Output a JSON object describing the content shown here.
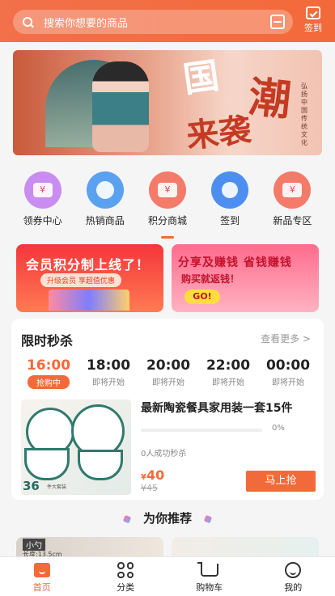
{
  "header": {
    "search_placeholder": "搜索你想要的商品",
    "signin_label": "签到"
  },
  "banner": {
    "big1": "国",
    "big2": "潮",
    "big3": "来袭",
    "vertical": "弘扬中国传统文化"
  },
  "categories": [
    {
      "label": "领券中心",
      "color": "#c98cf0"
    },
    {
      "label": "热销商品",
      "color": "#5aa2f0"
    },
    {
      "label": "积分商城",
      "color": "#f47a6a"
    },
    {
      "label": "签到",
      "color": "#4d8ff0"
    },
    {
      "label": "新品专区",
      "color": "#f47a6a"
    }
  ],
  "promos": {
    "left_title": "会员积分制上线了！",
    "left_sub": "升级会员 享超值优惠",
    "right_title": "分享及赚钱 省钱赚钱",
    "right_sub": "购买就返钱！",
    "right_go": "GO!"
  },
  "flash": {
    "title": "限时秒杀",
    "more": "查看更多 >",
    "times": [
      {
        "time": "16:00",
        "status": "抢购中"
      },
      {
        "time": "18:00",
        "status": "即将开始"
      },
      {
        "time": "20:00",
        "status": "即将开始"
      },
      {
        "time": "22:00",
        "status": "即将开始"
      },
      {
        "time": "00:00",
        "status": "即将开始"
      }
    ],
    "product": {
      "name": "最新陶瓷餐具家用装一套15件",
      "progress_pct": "0%",
      "progress": 0,
      "sold": "0人成功秒杀",
      "price": "40",
      "currency": "¥",
      "old_price": "¥45",
      "buy_label": "马上抢",
      "img_num": "36",
      "img_sub": "件大套装"
    }
  },
  "recommend": {
    "title": "为你推荐",
    "card1_label": "小勺",
    "card1_sub": "长度:13.5cm"
  },
  "tabbar": {
    "home": "首页",
    "category": "分类",
    "cart": "购物车",
    "mine": "我的"
  },
  "colors": {
    "accent": "#f36a3a"
  }
}
